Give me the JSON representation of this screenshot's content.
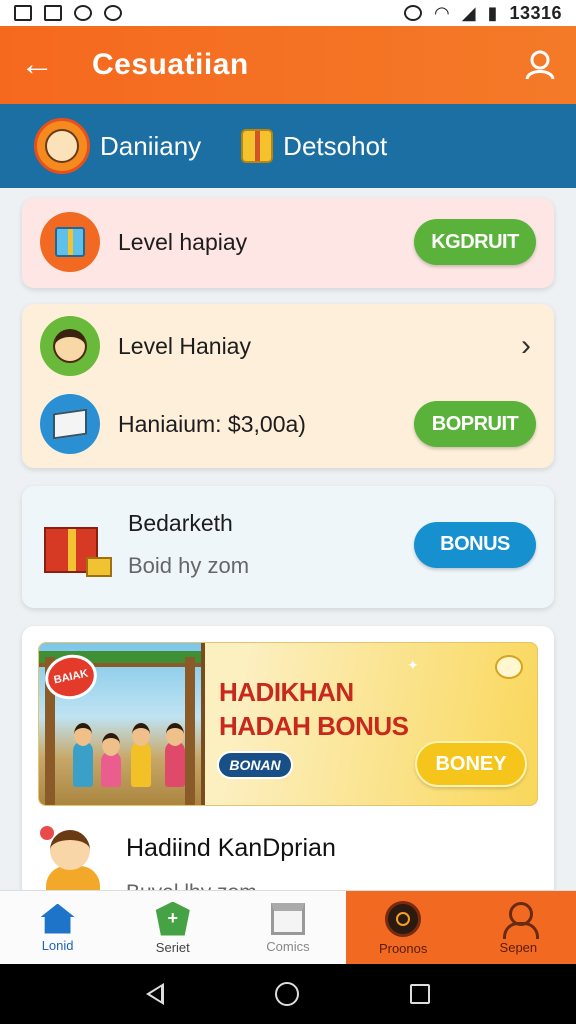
{
  "status_bar": {
    "time": "13316",
    "left_icons": [
      "notification-icon",
      "image-icon",
      "app-icon",
      "shield-icon"
    ],
    "right_icons": [
      "alarm-icon",
      "wifi-icon",
      "signal-icon",
      "battery-icon"
    ]
  },
  "app_bar": {
    "title": "Cesuatiian",
    "back_icon": "back-arrow-icon",
    "profile_icon": "profile-icon"
  },
  "tabs": [
    {
      "label": "Daniiany",
      "icon": "avatar-icon"
    },
    {
      "label": "Detsohot",
      "icon": "gift-icon"
    }
  ],
  "cards": {
    "card1": {
      "label": "Level hapiay",
      "button": "KGDRUIT",
      "icon": "gift-icon"
    },
    "card2": {
      "row1": {
        "label": "Level Haniay",
        "icon": "face-icon"
      },
      "row2": {
        "label": "Haniaium: $3,00a)",
        "button": "BOPRUIT",
        "icon": "box-icon"
      }
    },
    "card3": {
      "title": "Bedarketh",
      "subtitle": "Boid hy zom",
      "button": "BONUS"
    },
    "card4": {
      "banner": {
        "badge": "BAIAK",
        "title_line1": "HADIKHAN",
        "title_line2": "HADAH BONUS",
        "chip": "BONAN",
        "button": "BONEY"
      },
      "item": {
        "title": "Hadiind KanDprian",
        "subtitle": "Buvel lhy zom"
      }
    }
  },
  "bottom_nav": [
    {
      "label": "Lonid",
      "icon": "home-icon",
      "active": false
    },
    {
      "label": "Seriet",
      "icon": "shield-icon",
      "active": false
    },
    {
      "label": "Comics",
      "icon": "store-icon",
      "active": false
    },
    {
      "label": "Proonos",
      "icon": "disc-icon",
      "active": true
    },
    {
      "label": "Sepen",
      "icon": "person-icon",
      "active": true
    }
  ],
  "colors": {
    "app_bar": "#f5691e",
    "tab_strip": "#1b6fa3",
    "green_button": "#5ab23a",
    "blue_button": "#1690cf",
    "banner_button": "#f5c51c",
    "nav_active": "#f26a22"
  }
}
